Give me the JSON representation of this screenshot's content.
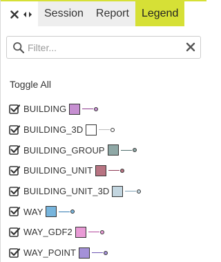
{
  "colors": {
    "accent": "#d6e036",
    "tab_inactive_bg": "#eeeeee"
  },
  "controls": {
    "close_icon": "close-x-icon",
    "swap_icon": "swap-arrows-icon"
  },
  "tabs": [
    {
      "label": "Session",
      "active": false
    },
    {
      "label": "Report",
      "active": false
    },
    {
      "label": "Legend",
      "active": true
    }
  ],
  "filter": {
    "placeholder": "Filter...",
    "value": "",
    "search_icon": "search-icon",
    "clear_icon": "clear-x-icon"
  },
  "toggle_all_label": "Toggle All",
  "layers": [
    {
      "name": "BUILDING",
      "checked": true,
      "fill": "#c68fd1",
      "line": "#8e3a8e"
    },
    {
      "name": "BUILDING_3D",
      "checked": true,
      "fill": "#ffffff",
      "line": "#bbbbbb"
    },
    {
      "name": "BUILDING_GROUP",
      "checked": true,
      "fill": "#8fa8a6",
      "line": "#4f6f6c"
    },
    {
      "name": "BUILDING_UNIT",
      "checked": true,
      "fill": "#b87482",
      "line": "#8e3a55"
    },
    {
      "name": "BUILDING_UNIT_3D",
      "checked": true,
      "fill": "#c3d6e0",
      "line": "#7fa2b5"
    },
    {
      "name": "WAY",
      "checked": true,
      "fill": "#77b5dd",
      "line": "#2f7ab0"
    },
    {
      "name": "WAY_GDF2",
      "checked": true,
      "fill": "#e99bd6",
      "line": "#b3479c"
    },
    {
      "name": "WAY_POINT",
      "checked": true,
      "fill": "#a491d8",
      "line": "#6d55b3"
    }
  ]
}
